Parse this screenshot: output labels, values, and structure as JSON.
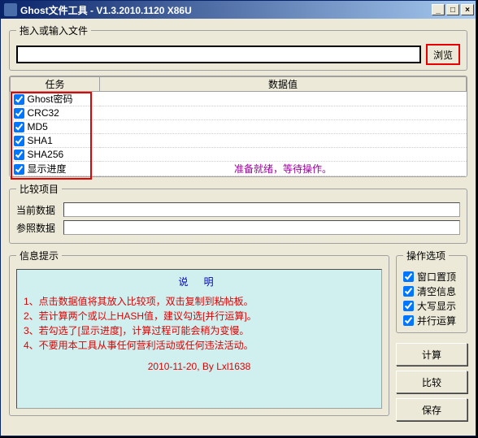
{
  "title": "Ghost文件工具 - V1.3.2010.1120 X86U",
  "file_group": {
    "legend": "拖入或输入文件",
    "value": "",
    "browse": "浏览"
  },
  "task": {
    "col_task": "任务",
    "col_value": "数据值",
    "items": [
      {
        "label": "Ghost密码",
        "checked": true,
        "value": ""
      },
      {
        "label": "CRC32",
        "checked": true,
        "value": ""
      },
      {
        "label": "MD5",
        "checked": true,
        "value": ""
      },
      {
        "label": "SHA1",
        "checked": true,
        "value": ""
      },
      {
        "label": "SHA256",
        "checked": true,
        "value": ""
      },
      {
        "label": "显示进度",
        "checked": true,
        "value": "准备就绪，等待操作。"
      }
    ]
  },
  "compare": {
    "legend": "比较项目",
    "current_label": "当前数据",
    "current_value": "",
    "ref_label": "参照数据",
    "ref_value": ""
  },
  "info": {
    "legend": "信息提示",
    "heading": "说 明",
    "lines": [
      "1、点击数据值将其放入比较项，双击复制到粘帖板。",
      "2、若计算两个或以上HASH值，建议勾选[并行运算]。",
      "3、若勾选了[显示进度]，计算过程可能会稍为变慢。",
      "4、不要用本工具从事任何营利活动或任何违法活动。"
    ],
    "footer": "2010-11-20, By Lxl1638"
  },
  "options": {
    "legend": "操作选项",
    "items": [
      {
        "label": "窗口置顶",
        "checked": true
      },
      {
        "label": "清空信息",
        "checked": true
      },
      {
        "label": "大写显示",
        "checked": true
      },
      {
        "label": "并行运算",
        "checked": true
      }
    ]
  },
  "actions": {
    "calc": "计算",
    "compare": "比较",
    "save": "保存"
  }
}
